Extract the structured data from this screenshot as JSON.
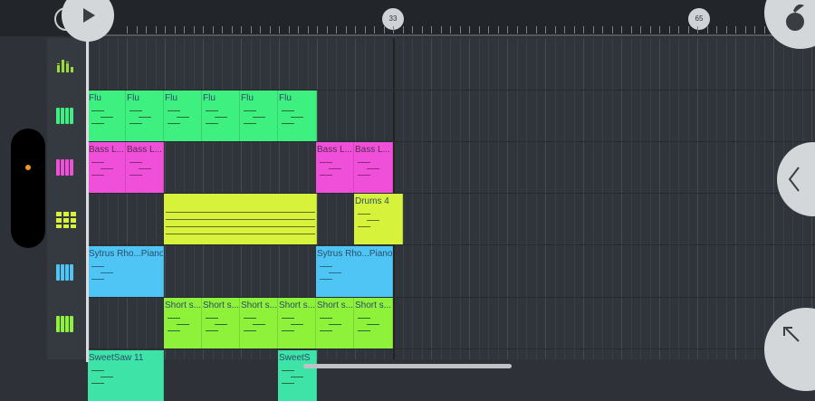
{
  "ruler": {
    "markers": [
      "33",
      "65"
    ]
  },
  "colors": {
    "flute": "#3ef07f",
    "bass": "#f04fd9",
    "drums": "#d7f23a",
    "sytrus": "#4ec5f4",
    "short": "#8ef23a",
    "accent": "#f7941d"
  },
  "tracks": [
    {
      "icon": "mixer-bars-icon",
      "clips": []
    },
    {
      "icon": "piano-roll-green-icon",
      "clips": [
        {
          "label": "Flu"
        },
        {
          "label": "Flu"
        },
        {
          "label": "Flu"
        },
        {
          "label": "Flu"
        },
        {
          "label": "Flu"
        },
        {
          "label": "Flu"
        }
      ]
    },
    {
      "icon": "piano-roll-pink-icon",
      "clips": [
        {
          "label": "Bass L..."
        },
        {
          "label": "Bass L..."
        },
        {
          "label": "Bass L..."
        },
        {
          "label": "Bass L..."
        }
      ]
    },
    {
      "icon": "drum-pads-icon",
      "clips": [
        {
          "label": ""
        },
        {
          "label": "Drums 4"
        }
      ]
    },
    {
      "icon": "piano-roll-blue-icon",
      "clips": [
        {
          "label": "Sytrus Rho...Piano"
        },
        {
          "label": "Sytrus Rho...Piano"
        }
      ]
    },
    {
      "icon": "piano-roll-lime-icon",
      "clips": [
        {
          "label": "Short s..."
        },
        {
          "label": "Short s..."
        },
        {
          "label": "Short s..."
        },
        {
          "label": "Short s..."
        },
        {
          "label": "Short s..."
        },
        {
          "label": "Short s..."
        }
      ]
    },
    {
      "icon": "piano-roll-teal-icon",
      "clips": [
        {
          "label": "SweetSaw 11"
        },
        {
          "label": "SweetS"
        }
      ]
    }
  ]
}
